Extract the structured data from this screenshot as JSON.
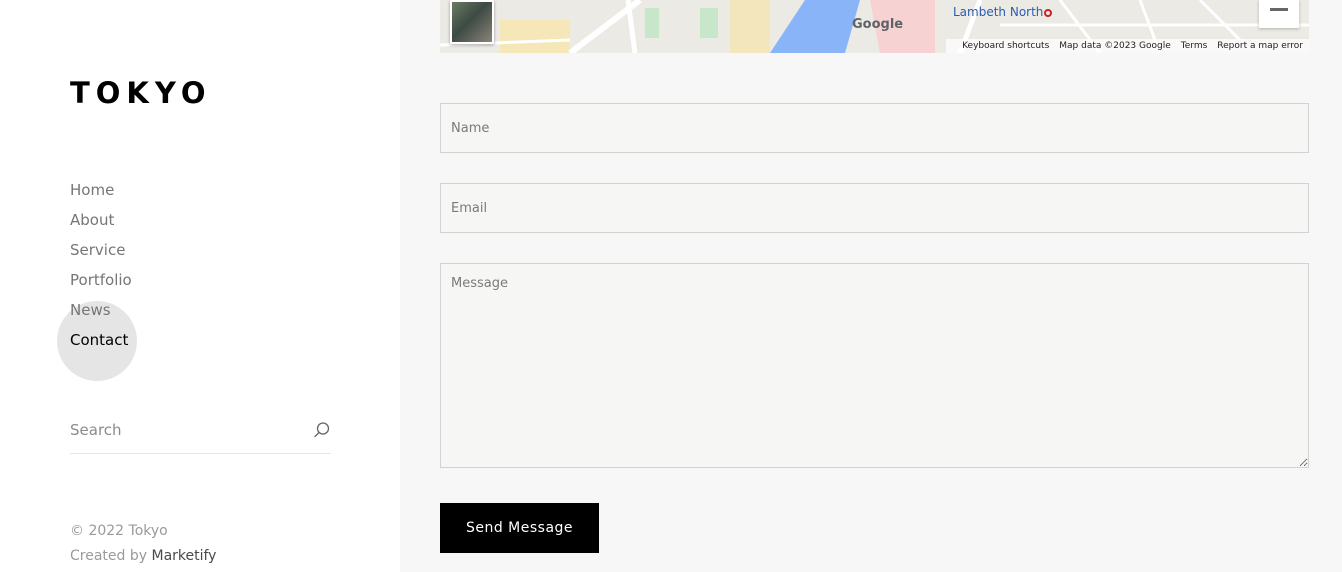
{
  "brand": {
    "logo": "TOKYO"
  },
  "nav": {
    "items": [
      {
        "label": "Home"
      },
      {
        "label": "About"
      },
      {
        "label": "Service"
      },
      {
        "label": "Portfolio"
      },
      {
        "label": "News"
      },
      {
        "label": "Contact",
        "active": true
      }
    ]
  },
  "search": {
    "placeholder": "Search",
    "icon": "search-icon"
  },
  "footer": {
    "copyright": "© 2022 Tokyo",
    "created_by_prefix": "Created by ",
    "created_by_link": "Marketify"
  },
  "map": {
    "brand": "Google",
    "place_label": "Lambeth North",
    "footer_links": [
      "Keyboard shortcuts",
      "Map data ©2023 Google",
      "Terms",
      "Report a map error"
    ]
  },
  "form": {
    "name_placeholder": "Name",
    "email_placeholder": "Email",
    "message_placeholder": "Message",
    "submit_label": "Send Message"
  },
  "colors": {
    "accent": "#000000",
    "main_bg": "#f7f7f7",
    "sidebar_bg": "#ffffff",
    "nav_text": "#767676",
    "nav_active": "#000000"
  }
}
